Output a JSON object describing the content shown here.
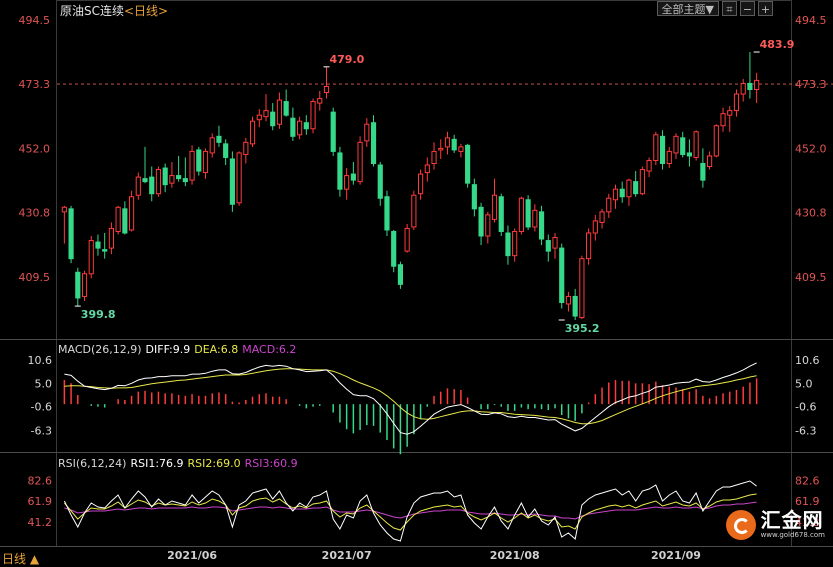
{
  "header": {
    "symbol_name": "原油SC连续",
    "period_tag": "<日线>",
    "main_menu_label": "全部主题▼"
  },
  "colors": {
    "up": "#ff3b3b",
    "down": "#36d88a",
    "label_red": "#ff5a5a",
    "label_green": "#64d8a4",
    "diff_line": "#ffffff",
    "dea_line": "#e8e84a",
    "macd_label": "#cc44cc",
    "rsi1_line": "#ffffff",
    "rsi2_line": "#e8e84a",
    "rsi3_line": "#cc44cc",
    "dashed_ref": "#e06050"
  },
  "footer": {
    "period_label": "日线 ▲"
  },
  "logo": {
    "brand": "汇金网",
    "url": "www.gold678.com"
  },
  "chart_data": [
    {
      "type": "candlestick",
      "panel": "price",
      "y_ticks": [
        "494.5",
        "473.3",
        "452.0",
        "430.8",
        "409.5"
      ],
      "ylim": [
        395.2,
        494.5
      ],
      "reference_line": 473.3,
      "x_tick_labels": [
        "2021/06",
        "2021/07",
        "2021/08",
        "2021/09"
      ],
      "x_tick_positions": [
        19,
        42,
        67,
        91
      ],
      "annotations": [
        {
          "text": "399.8",
          "index": 2,
          "value": 399.8,
          "kind": "low"
        },
        {
          "text": "479.0",
          "index": 39,
          "value": 479.0,
          "kind": "high"
        },
        {
          "text": "395.2",
          "index": 74,
          "value": 395.2,
          "kind": "low"
        },
        {
          "text": "483.9",
          "index": 103,
          "value": 483.9,
          "kind": "high"
        }
      ],
      "ohlc": [
        [
          431.0,
          433.0,
          420.5,
          432.5
        ],
        [
          432.0,
          433.0,
          414.0,
          415.5
        ],
        [
          411.0,
          412.5,
          399.8,
          402.5
        ],
        [
          403.0,
          411.5,
          401.5,
          410.5
        ],
        [
          410.5,
          423.0,
          409.0,
          421.5
        ],
        [
          421.0,
          423.5,
          416.5,
          419.0
        ],
        [
          418.5,
          424.0,
          415.5,
          418.0
        ],
        [
          419.0,
          427.5,
          417.0,
          425.5
        ],
        [
          424.5,
          433.0,
          423.5,
          432.5
        ],
        [
          432.0,
          434.5,
          423.5,
          424.0
        ],
        [
          425.0,
          438.0,
          424.5,
          436.0
        ],
        [
          436.5,
          444.0,
          435.0,
          442.5
        ],
        [
          442.0,
          452.5,
          440.5,
          441.0
        ],
        [
          442.5,
          446.0,
          434.5,
          437.0
        ],
        [
          437.0,
          446.0,
          436.0,
          445.0
        ],
        [
          445.5,
          447.0,
          437.5,
          440.0
        ],
        [
          440.5,
          447.5,
          439.0,
          443.0
        ],
        [
          443.0,
          449.5,
          441.0,
          442.0
        ],
        [
          442.0,
          449.0,
          439.5,
          441.0
        ],
        [
          441.5,
          453.0,
          440.0,
          451.0
        ],
        [
          451.5,
          452.5,
          443.0,
          444.5
        ],
        [
          444.0,
          452.0,
          442.0,
          451.0
        ],
        [
          450.5,
          457.0,
          449.0,
          455.5
        ],
        [
          456.0,
          459.5,
          452.5,
          454.0
        ],
        [
          453.5,
          455.0,
          446.5,
          449.0
        ],
        [
          448.5,
          451.0,
          431.0,
          433.5
        ],
        [
          434.0,
          451.0,
          433.0,
          450.5
        ],
        [
          450.0,
          455.5,
          447.0,
          454.0
        ],
        [
          453.5,
          462.5,
          452.5,
          461.0
        ],
        [
          461.5,
          465.0,
          459.0,
          463.0
        ],
        [
          462.5,
          470.0,
          461.0,
          464.5
        ],
        [
          464.0,
          467.0,
          458.0,
          459.5
        ],
        [
          460.0,
          470.5,
          458.5,
          468.0
        ],
        [
          467.5,
          471.5,
          462.5,
          463.0
        ],
        [
          462.0,
          465.5,
          454.5,
          456.0
        ],
        [
          456.5,
          462.5,
          455.0,
          461.0
        ],
        [
          460.5,
          463.0,
          456.5,
          458.5
        ],
        [
          458.5,
          468.5,
          457.0,
          467.5
        ],
        [
          467.0,
          471.0,
          464.5,
          468.5
        ],
        [
          470.5,
          479.0,
          468.5,
          472.5
        ],
        [
          464.0,
          465.5,
          449.5,
          451.0
        ],
        [
          450.5,
          452.5,
          436.0,
          438.5
        ],
        [
          438.5,
          445.5,
          435.0,
          443.0
        ],
        [
          443.5,
          447.5,
          440.0,
          441.5
        ],
        [
          441.0,
          456.0,
          440.0,
          454.0
        ],
        [
          454.5,
          462.0,
          452.5,
          460.0
        ],
        [
          460.5,
          463.0,
          446.0,
          447.0
        ],
        [
          446.5,
          447.5,
          433.0,
          435.5
        ],
        [
          436.0,
          438.0,
          423.0,
          425.0
        ],
        [
          424.5,
          425.0,
          411.0,
          413.0
        ],
        [
          413.5,
          414.5,
          405.5,
          407.0
        ],
        [
          418.0,
          427.0,
          417.5,
          425.5
        ],
        [
          426.0,
          438.0,
          425.0,
          436.5
        ],
        [
          437.0,
          445.0,
          435.0,
          443.5
        ],
        [
          444.0,
          449.0,
          441.0,
          446.5
        ],
        [
          447.0,
          454.0,
          445.0,
          451.0
        ],
        [
          451.5,
          455.0,
          448.5,
          452.0
        ],
        [
          452.5,
          457.5,
          450.0,
          455.5
        ],
        [
          455.0,
          456.5,
          450.5,
          451.5
        ],
        [
          451.0,
          453.5,
          449.0,
          452.5
        ],
        [
          453.0,
          453.5,
          439.0,
          440.5
        ],
        [
          440.0,
          442.0,
          429.5,
          432.0
        ],
        [
          432.5,
          434.0,
          420.0,
          423.0
        ],
        [
          423.0,
          431.0,
          420.5,
          430.0
        ],
        [
          428.5,
          442.0,
          427.5,
          436.5
        ],
        [
          436.0,
          437.0,
          423.0,
          424.5
        ],
        [
          424.0,
          426.5,
          413.5,
          416.5
        ],
        [
          416.5,
          425.5,
          414.5,
          424.5
        ],
        [
          424.5,
          436.0,
          423.5,
          435.5
        ],
        [
          435.0,
          436.5,
          425.0,
          426.0
        ],
        [
          426.0,
          433.5,
          424.5,
          431.5
        ],
        [
          431.0,
          433.0,
          420.0,
          422.0
        ],
        [
          421.5,
          423.5,
          414.5,
          418.0
        ],
        [
          419.0,
          424.0,
          415.5,
          422.5
        ],
        [
          419.0,
          420.5,
          399.0,
          401.0
        ],
        [
          400.5,
          404.5,
          398.0,
          403.0
        ],
        [
          403.0,
          405.5,
          395.2,
          396.5
        ],
        [
          396.0,
          416.5,
          395.5,
          415.5
        ],
        [
          415.5,
          425.5,
          413.5,
          424.0
        ],
        [
          424.0,
          430.0,
          421.5,
          428.0
        ],
        [
          427.5,
          432.0,
          425.5,
          431.0
        ],
        [
          431.0,
          437.0,
          429.0,
          435.5
        ],
        [
          435.0,
          440.0,
          432.0,
          438.5
        ],
        [
          438.5,
          441.0,
          434.0,
          436.0
        ],
        [
          436.0,
          442.0,
          433.0,
          441.5
        ],
        [
          441.0,
          444.5,
          436.0,
          437.0
        ],
        [
          437.0,
          446.0,
          436.5,
          445.0
        ],
        [
          444.5,
          449.0,
          442.5,
          448.0
        ],
        [
          448.0,
          457.5,
          446.5,
          456.5
        ],
        [
          456.0,
          458.0,
          445.0,
          447.0
        ],
        [
          447.0,
          452.5,
          445.5,
          451.0
        ],
        [
          450.5,
          457.0,
          448.5,
          456.0
        ],
        [
          455.5,
          457.5,
          449.0,
          450.0
        ],
        [
          450.5,
          455.0,
          446.0,
          449.5
        ],
        [
          449.0,
          458.0,
          448.0,
          457.5
        ],
        [
          447.0,
          452.0,
          439.0,
          441.5
        ],
        [
          446.0,
          451.0,
          445.0,
          449.5
        ],
        [
          449.5,
          460.0,
          449.0,
          459.5
        ],
        [
          459.5,
          465.5,
          457.5,
          463.5
        ],
        [
          463.0,
          466.0,
          457.5,
          464.5
        ],
        [
          464.5,
          471.5,
          462.5,
          470.0
        ],
        [
          470.0,
          475.0,
          467.5,
          473.5
        ],
        [
          473.5,
          483.9,
          468.5,
          471.5
        ],
        [
          471.5,
          477.0,
          467.0,
          474.5
        ]
      ]
    },
    {
      "type": "line+bar",
      "panel": "macd",
      "title": "MACD(26,12,9)",
      "legend": {
        "diff": "DIFF:9.9",
        "dea": "DEA:6.8",
        "macd": "MACD:6.2"
      },
      "y_ticks": [
        "10.6",
        "5.0",
        "-0.6",
        "-6.3"
      ],
      "ylim": [
        -10.5,
        12.5
      ],
      "diff": [
        7.2,
        6.9,
        5.5,
        4.3,
        4.0,
        3.7,
        3.5,
        3.8,
        4.5,
        4.4,
        5.0,
        5.8,
        6.2,
        6.3,
        6.6,
        6.6,
        6.8,
        6.8,
        6.8,
        7.2,
        7.2,
        7.4,
        7.9,
        8.2,
        8.2,
        7.3,
        7.2,
        7.6,
        8.3,
        8.9,
        9.3,
        9.1,
        9.3,
        9.1,
        8.5,
        8.2,
        7.8,
        7.9,
        8.0,
        8.2,
        6.9,
        5.1,
        3.6,
        2.3,
        2.0,
        2.0,
        1.3,
        -0.3,
        -2.3,
        -4.6,
        -6.8,
        -7.2,
        -6.6,
        -5.3,
        -3.9,
        -2.4,
        -1.5,
        -0.7,
        -0.4,
        -0.1,
        -0.8,
        -1.6,
        -2.4,
        -2.5,
        -2.1,
        -2.3,
        -3.0,
        -3.2,
        -2.9,
        -3.2,
        -3.2,
        -3.5,
        -3.8,
        -3.7,
        -4.8,
        -5.6,
        -6.4,
        -5.8,
        -4.5,
        -3.2,
        -1.9,
        -0.6,
        0.4,
        1.0,
        1.7,
        2.0,
        2.6,
        3.1,
        4.1,
        4.3,
        4.6,
        5.0,
        5.2,
        5.3,
        6.0,
        5.4,
        5.3,
        5.8,
        6.4,
        6.9,
        7.5,
        8.2,
        9.1,
        9.9
      ],
      "dea": [
        4.3,
        4.4,
        4.4,
        4.3,
        4.2,
        4.0,
        3.9,
        3.8,
        3.9,
        3.9,
        4.0,
        4.3,
        4.6,
        4.9,
        5.1,
        5.3,
        5.5,
        5.7,
        5.8,
        6.0,
        6.2,
        6.4,
        6.6,
        6.8,
        7.0,
        7.0,
        7.0,
        7.1,
        7.4,
        7.7,
        8.0,
        8.2,
        8.4,
        8.5,
        8.5,
        8.4,
        8.3,
        8.2,
        8.2,
        8.2,
        7.9,
        7.3,
        6.6,
        5.8,
        5.1,
        4.5,
        3.9,
        3.1,
        2.0,
        0.7,
        -0.8,
        -2.1,
        -3.0,
        -3.5,
        -3.6,
        -3.4,
        -3.0,
        -2.6,
        -2.2,
        -1.8,
        -1.6,
        -1.6,
        -1.8,
        -1.9,
        -2.0,
        -2.0,
        -2.2,
        -2.4,
        -2.5,
        -2.6,
        -2.7,
        -2.9,
        -3.1,
        -3.2,
        -3.5,
        -3.9,
        -4.4,
        -4.7,
        -4.7,
        -4.4,
        -3.9,
        -3.2,
        -2.5,
        -1.8,
        -1.1,
        -0.5,
        0.1,
        0.7,
        1.4,
        2.0,
        2.5,
        3.0,
        3.4,
        3.8,
        4.2,
        4.4,
        4.6,
        4.8,
        5.1,
        5.4,
        5.8,
        6.1,
        6.5,
        6.8
      ],
      "macd": [
        5.8,
        5.0,
        2.2,
        0.0,
        -0.4,
        -0.6,
        -0.8,
        0.0,
        1.2,
        1.0,
        2.0,
        3.0,
        3.2,
        2.8,
        3.0,
        2.6,
        2.6,
        2.2,
        2.0,
        2.4,
        2.0,
        2.0,
        2.6,
        2.8,
        2.4,
        0.6,
        0.4,
        1.0,
        1.8,
        2.4,
        2.6,
        1.8,
        1.8,
        1.2,
        0.0,
        -0.4,
        -1.0,
        -0.6,
        -0.4,
        0.0,
        -2.0,
        -4.4,
        -6.0,
        -7.0,
        -6.2,
        -5.0,
        -5.2,
        -6.8,
        -8.6,
        -10.6,
        -12.0,
        -10.2,
        -7.2,
        -3.6,
        -0.6,
        2.0,
        3.0,
        3.8,
        3.6,
        3.4,
        1.6,
        0.0,
        -1.2,
        -1.2,
        -0.2,
        -0.6,
        -1.6,
        -1.6,
        -0.8,
        -1.2,
        -1.0,
        -1.2,
        -1.4,
        -1.0,
        -2.6,
        -3.4,
        -4.0,
        -2.2,
        0.4,
        2.4,
        4.0,
        5.2,
        5.8,
        5.6,
        5.6,
        5.0,
        5.0,
        4.8,
        5.4,
        4.6,
        4.2,
        4.0,
        3.6,
        3.0,
        3.6,
        2.0,
        1.4,
        2.0,
        2.6,
        3.0,
        3.4,
        4.2,
        5.2,
        6.2
      ]
    },
    {
      "type": "line",
      "panel": "rsi",
      "title": "RSI(6,12,24)",
      "legend": {
        "rsi1": "RSI1:76.9",
        "rsi2": "RSI2:69.0",
        "rsi3": "RSI3:60.9"
      },
      "y_ticks": [
        "82.6",
        "61.9",
        "41.2"
      ],
      "ylim": [
        18,
        95
      ],
      "rsi1": [
        62,
        48,
        36,
        50,
        60,
        56,
        55,
        62,
        68,
        55,
        64,
        72,
        66,
        56,
        64,
        58,
        62,
        60,
        58,
        68,
        60,
        66,
        72,
        68,
        58,
        36,
        58,
        62,
        70,
        72,
        74,
        64,
        72,
        60,
        52,
        60,
        56,
        66,
        68,
        72,
        44,
        34,
        48,
        45,
        62,
        68,
        50,
        38,
        30,
        24,
        22,
        46,
        60,
        66,
        68,
        70,
        70,
        72,
        66,
        68,
        48,
        40,
        34,
        46,
        56,
        42,
        34,
        48,
        60,
        46,
        54,
        42,
        38,
        46,
        26,
        30,
        24,
        58,
        64,
        68,
        70,
        72,
        74,
        68,
        72,
        62,
        72,
        74,
        78,
        62,
        68,
        72,
        62,
        60,
        70,
        52,
        62,
        72,
        76,
        76,
        78,
        80,
        82,
        76.9
      ],
      "rsi2": [
        60,
        52,
        44,
        50,
        55,
        54,
        54,
        57,
        61,
        55,
        59,
        63,
        61,
        57,
        60,
        58,
        59,
        58,
        57,
        61,
        58,
        60,
        64,
        62,
        58,
        48,
        55,
        57,
        62,
        64,
        65,
        61,
        64,
        59,
        55,
        57,
        55,
        59,
        60,
        62,
        52,
        46,
        50,
        49,
        55,
        58,
        52,
        46,
        40,
        35,
        33,
        41,
        48,
        52,
        54,
        56,
        57,
        58,
        56,
        57,
        50,
        46,
        43,
        46,
        50,
        45,
        41,
        45,
        50,
        45,
        48,
        44,
        42,
        44,
        36,
        37,
        34,
        46,
        50,
        53,
        55,
        57,
        58,
        56,
        58,
        55,
        58,
        60,
        62,
        57,
        59,
        61,
        58,
        57,
        60,
        54,
        57,
        61,
        63,
        63,
        64,
        66,
        68,
        69.0
      ],
      "rsi3": [
        55,
        53,
        50,
        51,
        52,
        52,
        52,
        53,
        54,
        53,
        54,
        55,
        55,
        54,
        55,
        55,
        55,
        55,
        55,
        56,
        55,
        55,
        56,
        56,
        55,
        52,
        53,
        54,
        55,
        56,
        56,
        55,
        56,
        55,
        54,
        54,
        54,
        55,
        55,
        56,
        53,
        51,
        51,
        51,
        52,
        53,
        52,
        50,
        48,
        46,
        45,
        47,
        49,
        50,
        51,
        52,
        52,
        53,
        53,
        53,
        51,
        50,
        49,
        49,
        50,
        49,
        48,
        48,
        49,
        48,
        49,
        48,
        47,
        47,
        45,
        45,
        44,
        47,
        49,
        50,
        51,
        52,
        53,
        53,
        53,
        53,
        54,
        55,
        56,
        55,
        55,
        56,
        55,
        55,
        56,
        54,
        55,
        57,
        58,
        58,
        59,
        59,
        60,
        60.9
      ]
    }
  ]
}
